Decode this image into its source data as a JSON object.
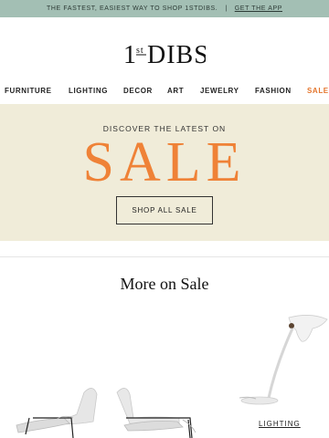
{
  "topbar": {
    "promo_text": "THE FASTEST, EASIEST WAY TO SHOP 1STDIBS.",
    "separator": "|",
    "app_link": "GET THE APP"
  },
  "brand": {
    "logo_text": "1stDIBS"
  },
  "nav": {
    "items": [
      {
        "label": "FURNITURE"
      },
      {
        "label": "LIGHTING"
      },
      {
        "label": "DECOR"
      },
      {
        "label": "ART"
      },
      {
        "label": "JEWELRY"
      },
      {
        "label": "FASHION"
      },
      {
        "label": "SALE"
      }
    ],
    "highlight_color": "#e4752c"
  },
  "banner": {
    "kicker": "DISCOVER THE LATEST ON",
    "title": "SALE",
    "cta_label": "SHOP ALL SALE",
    "background_color": "#f0ecd9",
    "title_color": "#ef8237"
  },
  "section": {
    "title": "More on Sale"
  },
  "products": [
    {
      "image": "lounge-chairs-pair"
    },
    {
      "image": "desk-lamp",
      "category_link": "LIGHTING"
    }
  ],
  "colors": {
    "topbar": "#a3bfb4",
    "accent": "#ef8237"
  }
}
